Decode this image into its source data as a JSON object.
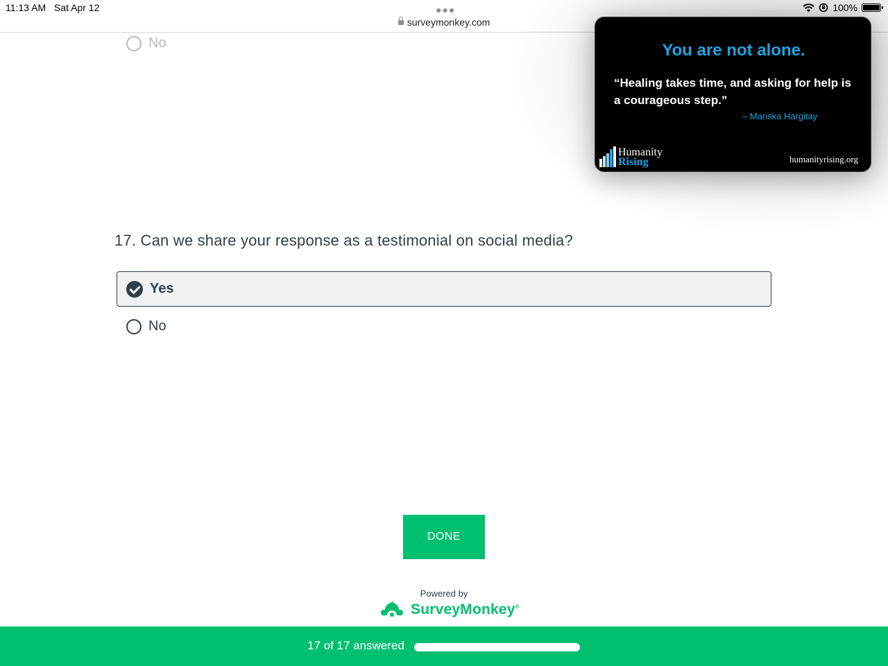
{
  "status_bar": {
    "time": "11:13 AM",
    "date": "Sat Apr 12",
    "battery": "100%"
  },
  "browser": {
    "url": "surveymonkey.com"
  },
  "previous_question": {
    "option_no": "No"
  },
  "question": {
    "text": "17. Can we share your response as a testimonial on social media?",
    "options": [
      {
        "label": "Yes",
        "selected": true
      },
      {
        "label": "No",
        "selected": false
      }
    ]
  },
  "done_button": "DONE",
  "footer": {
    "powered_by": "Powered by",
    "brand": "SurveyMonkey",
    "brand_mark": "®",
    "progress_text": "17 of 17 answered",
    "progress_fraction": 1.0
  },
  "ad": {
    "headline": "You are not alone.",
    "quote": "“Healing takes time, and asking for help is a courageous step.”",
    "author": "–  Mariska Hargitay",
    "logo_line1": "Humanity",
    "logo_line2": "Rising",
    "site": "humanityrising.org"
  },
  "colors": {
    "brand_green": "#00bf6f",
    "text_dark": "#333e48",
    "ad_accent": "#1fa2e1"
  }
}
